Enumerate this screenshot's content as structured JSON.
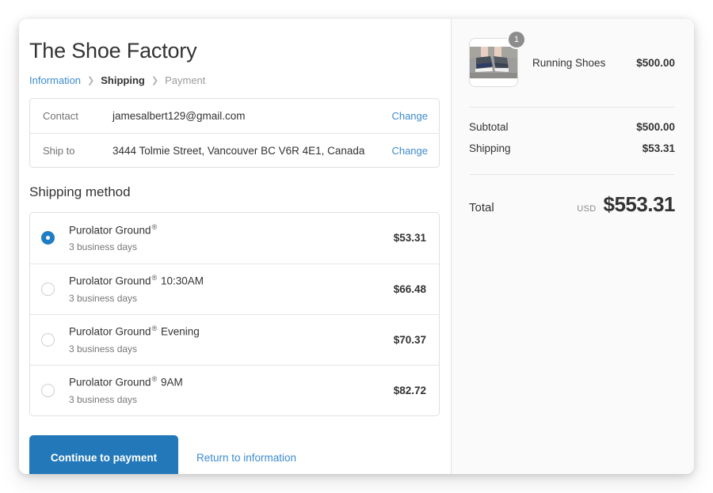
{
  "shop": {
    "title": "The Shoe Factory"
  },
  "breadcrumb": {
    "information": "Information",
    "shipping": "Shipping",
    "payment": "Payment",
    "separator": "❯"
  },
  "customer_info": {
    "rows": [
      {
        "label": "Contact",
        "value": "jamesalbert129@gmail.com",
        "action": "Change"
      },
      {
        "label": "Ship to",
        "value": "3444 Tolmie Street, Vancouver BC V6R 4E1, Canada",
        "action": "Change"
      }
    ]
  },
  "shipping_method": {
    "heading": "Shipping method",
    "registered_mark": "®",
    "options": [
      {
        "name": "Purolator Ground",
        "suffix": "",
        "days": "3 business days",
        "price": "$53.31",
        "selected": true
      },
      {
        "name": "Purolator Ground",
        "suffix": "10:30AM",
        "days": "3 business days",
        "price": "$66.48",
        "selected": false
      },
      {
        "name": "Purolator Ground",
        "suffix": "Evening",
        "days": "3 business days",
        "price": "$70.37",
        "selected": false
      },
      {
        "name": "Purolator Ground",
        "suffix": "9AM",
        "days": "3 business days",
        "price": "$82.72",
        "selected": false
      }
    ]
  },
  "actions": {
    "continue_label": "Continue to payment",
    "return_label": "Return to information"
  },
  "summary": {
    "item": {
      "name": "Running Shoes",
      "price": "$500.00",
      "quantity": "1",
      "image_name": "running-shoes-photo"
    },
    "subtotal_label": "Subtotal",
    "subtotal_value": "$500.00",
    "shipping_label": "Shipping",
    "shipping_value": "$53.31",
    "total_label": "Total",
    "currency": "USD",
    "total_value": "$553.31"
  },
  "colors": {
    "accent": "#2378ba",
    "link": "#3d8bcd",
    "radio_selected": "#1f7dc4",
    "badge": "#8c8c8c",
    "sidebar_bg": "#fafafa"
  }
}
